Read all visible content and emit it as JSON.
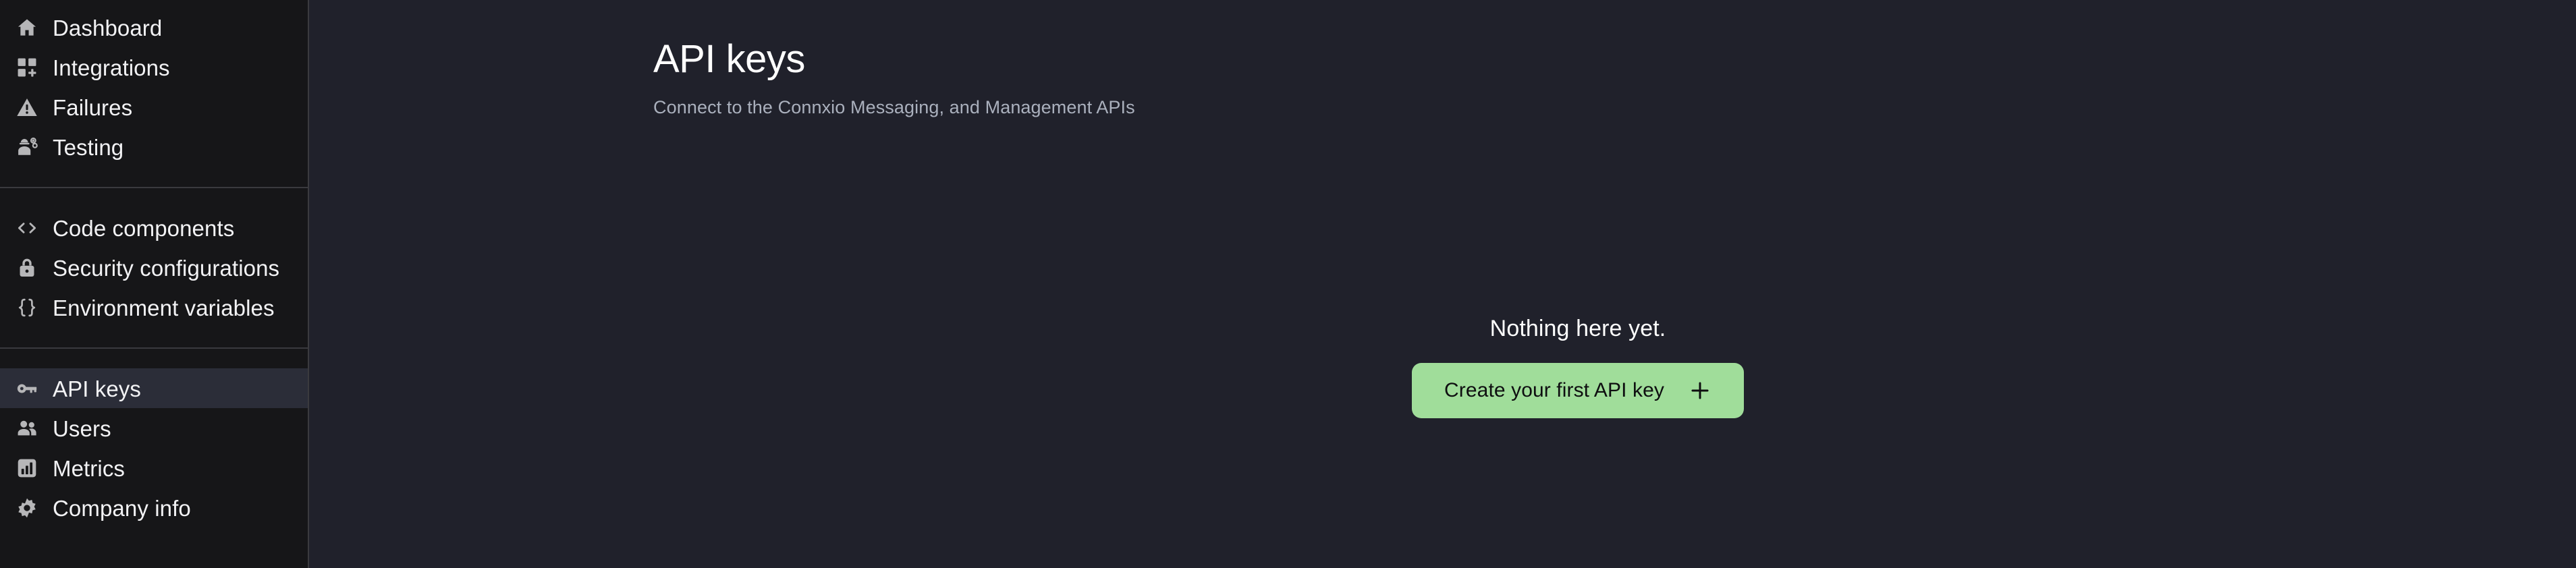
{
  "sidebar": {
    "groups": [
      {
        "items": [
          {
            "label": "Dashboard",
            "icon": "home-icon",
            "active": false
          },
          {
            "label": "Integrations",
            "icon": "grid-plus-icon",
            "active": false
          },
          {
            "label": "Failures",
            "icon": "warning-triangle-icon",
            "active": false
          },
          {
            "label": "Testing",
            "icon": "engineer-gear-icon",
            "active": false
          }
        ]
      },
      {
        "items": [
          {
            "label": "Code components",
            "icon": "code-brackets-icon",
            "active": false
          },
          {
            "label": "Security configurations",
            "icon": "lock-icon",
            "active": false
          },
          {
            "label": "Environment variables",
            "icon": "curly-braces-icon",
            "active": false
          }
        ]
      },
      {
        "items": [
          {
            "label": "API keys",
            "icon": "key-icon",
            "active": true
          },
          {
            "label": "Users",
            "icon": "users-icon",
            "active": false
          },
          {
            "label": "Metrics",
            "icon": "bar-chart-icon",
            "active": false
          },
          {
            "label": "Company info",
            "icon": "gear-icon",
            "active": false
          }
        ]
      }
    ]
  },
  "header": {
    "title": "API keys",
    "subtitle": "Connect to the Connxio Messaging, and Management APIs"
  },
  "empty_state": {
    "message": "Nothing here yet.",
    "button_label": "Create your first API key",
    "button_icon": "plus-icon"
  },
  "colors": {
    "sidebar_bg": "#161618",
    "main_bg": "#20212b",
    "active_item_bg": "#2b2d38",
    "divider": "#3a3a3e",
    "accent_green": "#a0dd9a",
    "text_primary": "#ffffff",
    "text_muted": "#aab0bd",
    "icon_gray": "#b6b6b8"
  }
}
